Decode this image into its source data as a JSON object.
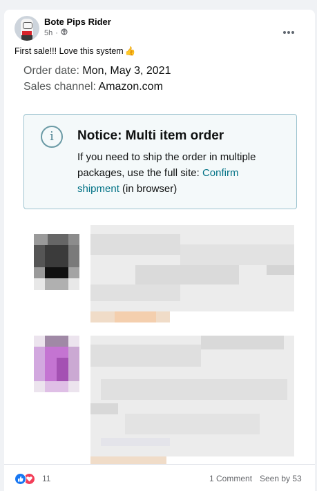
{
  "post": {
    "author": "Bote Pips Rider",
    "time": "5h",
    "audience_icon": "public-globe-icon",
    "text": "First sale!!! Love this system",
    "emoji": "👍",
    "more_icon": "more-options-icon"
  },
  "order": {
    "date_label": "Order date:",
    "date_value": "Mon, May 3, 2021",
    "channel_label": "Sales channel:",
    "channel_value": "Amazon.com"
  },
  "notice": {
    "icon": "info-icon",
    "icon_glyph": "i",
    "title": "Notice: Multi item order",
    "body_line1": "If you need to ship the order in multiple",
    "body_line2_pre": "packages, use the full site: ",
    "body_link1": "Confirm",
    "body_link2": "shipment",
    "body_post": " (in browser)"
  },
  "reactions": {
    "like_icon": "like-reaction-icon",
    "love_icon": "love-reaction-icon",
    "count": "11",
    "comments": "1 Comment",
    "seen": "Seen by 53"
  },
  "colors": {
    "like": "#1877f2",
    "love": "#f33e58",
    "link": "#007185",
    "notice_border": "#9cc3cf"
  }
}
